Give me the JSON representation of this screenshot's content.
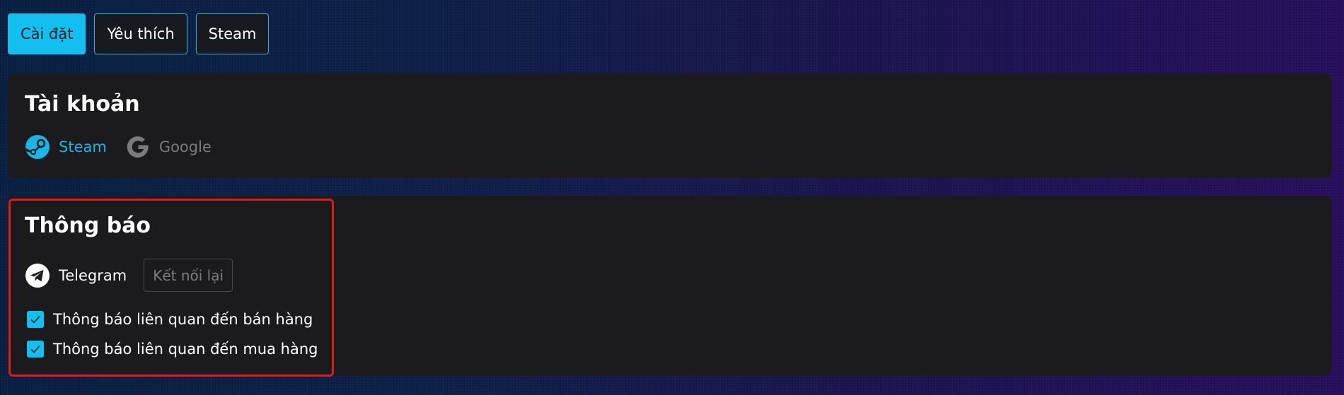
{
  "tabs": [
    {
      "label": "Cài đặt",
      "active": true
    },
    {
      "label": "Yêu thích",
      "active": false
    },
    {
      "label": "Steam",
      "active": false
    }
  ],
  "account": {
    "title": "Tài khoản",
    "providers": [
      {
        "label": "Steam",
        "icon": "steam-icon",
        "color": "#17b6e8",
        "linked": true
      },
      {
        "label": "Google",
        "icon": "google-icon",
        "color": "#7a7a7e",
        "linked": false
      }
    ]
  },
  "notifications": {
    "title": "Thông báo",
    "telegram": {
      "label": "Telegram",
      "icon": "telegram-icon",
      "reconnect_label": "Kết nối lại"
    },
    "options": [
      {
        "label": "Thông báo liên quan đến bán hàng",
        "checked": true
      },
      {
        "label": "Thông báo liên quan đến mua hàng",
        "checked": true
      }
    ]
  },
  "colors": {
    "accent": "#12c0f0",
    "card_bg": "#1b1b1d",
    "highlight": "#e01919"
  }
}
